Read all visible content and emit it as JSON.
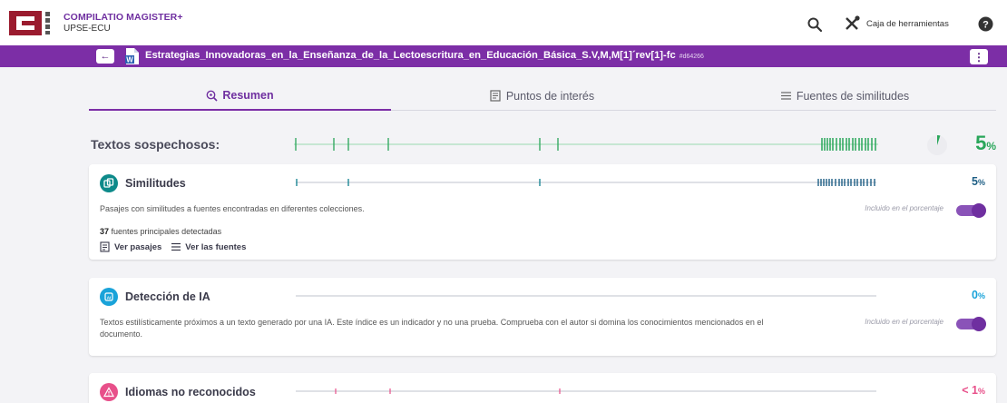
{
  "header": {
    "logo_letters": "CEBL",
    "brand_name": "COMPILATIO MAGISTER+",
    "institution": "UPSE-ECU",
    "tools_label": "Caja de herramientas",
    "icons": [
      "search-icon",
      "tools-icon",
      "help-icon"
    ]
  },
  "document": {
    "title": "Estrategias_Innovadoras_en_la_Enseñanza_de_la_Lectoescritura_en_Educación_Básica_S.V,M,M[1]´rev[1]-fc",
    "id": "#d64266"
  },
  "tabs": [
    {
      "label": "Resumen",
      "icon": "resumen-icon",
      "active": true
    },
    {
      "label": "Puntos de interés",
      "icon": "puntos-icon",
      "active": false
    },
    {
      "label": "Fuentes de similitudes",
      "icon": "list-icon",
      "active": false
    }
  ],
  "summary": {
    "label": "Textos sospechosos:",
    "percent": "5",
    "percent_unit": "%",
    "accent": "#29a65a"
  },
  "cards": {
    "similitudes": {
      "title": "Similitudes",
      "percent": "5",
      "unit": "%",
      "color": "#29a65a",
      "description": "Pasajes con similitudes a fuentes encontradas en diferentes colecciones.",
      "included": "Incluido en el porcentaje",
      "sources_count": "37",
      "sources_text": "fuentes principales detectadas",
      "link_passages": "Ver pasajes",
      "link_sources": "Ver las fuentes"
    },
    "ia": {
      "title": "Detección de IA",
      "percent": "0",
      "unit": "%",
      "color": "#1aa3d9",
      "description": "Textos estilísticamente próximos a un texto generado por una IA. Este índice es un indicador y no una prueba. Comprueba con el autor si domina los conocimientos mencionados en el documento.",
      "included": "Incluido en el porcentaje"
    },
    "idiomas": {
      "title": "Idiomas no reconocidos",
      "percent": "< 1",
      "unit": "%",
      "color": "#e8508a"
    }
  }
}
